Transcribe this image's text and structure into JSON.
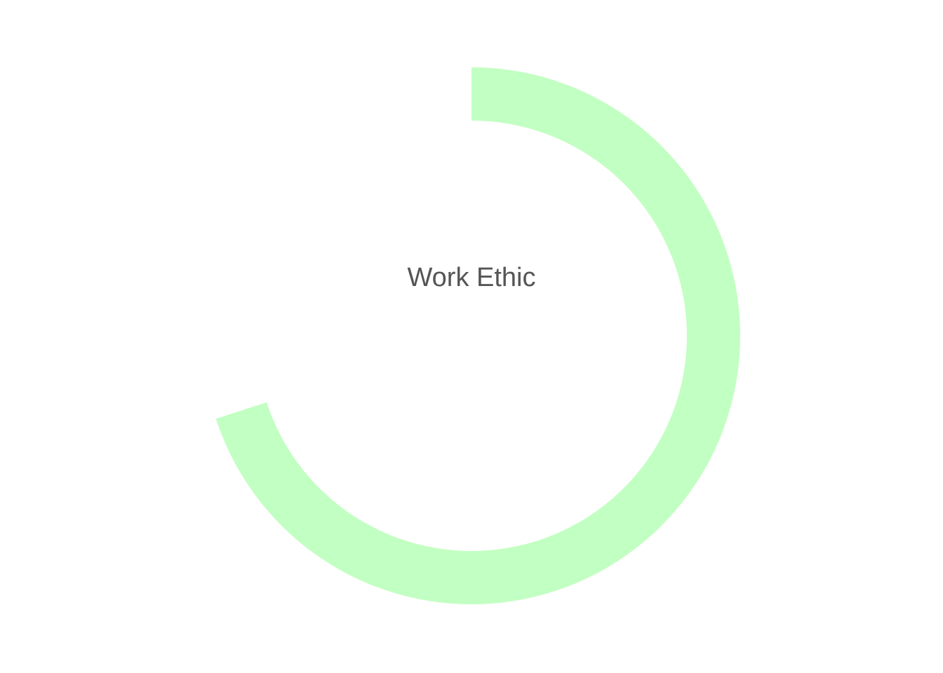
{
  "chart_data": {
    "type": "radial-progress",
    "label": "Work Ethic",
    "value": 70,
    "max": 100,
    "start": "top",
    "direction": "clockwise",
    "colors": {
      "arc": "#c2ffc2",
      "label": "#555555",
      "background": "#ffffff"
    }
  }
}
